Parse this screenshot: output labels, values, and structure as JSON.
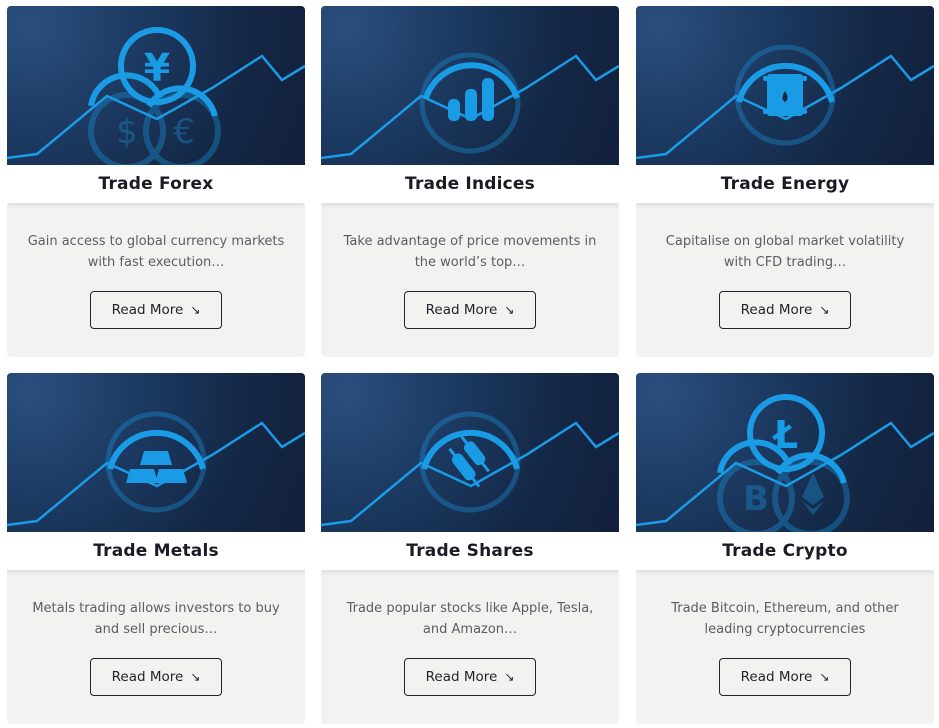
{
  "cards": [
    {
      "title": "Trade Forex",
      "description": "Gain access to global currency markets with fast execution…",
      "button_label": "Read More",
      "button_icon": "arrow-down-right-icon",
      "illustration": "forex-coins-icon"
    },
    {
      "title": "Trade Indices",
      "description": "Take advantage of price movements in the world’s top…",
      "button_label": "Read More",
      "button_icon": "arrow-down-right-icon",
      "illustration": "bar-chart-icon"
    },
    {
      "title": "Trade Energy",
      "description": "Capitalise on global market volatility with CFD trading…",
      "button_label": "Read More",
      "button_icon": "arrow-down-right-icon",
      "illustration": "oil-barrel-icon"
    },
    {
      "title": "Trade Metals",
      "description": "Metals trading allows investors to buy and sell precious…",
      "button_label": "Read More",
      "button_icon": "arrow-down-right-icon",
      "illustration": "gold-bars-icon"
    },
    {
      "title": "Trade Shares",
      "description": "Trade popular stocks like Apple, Tesla, and Amazon…",
      "button_label": "Read More",
      "button_icon": "arrow-down-right-icon",
      "illustration": "candlestick-icon"
    },
    {
      "title": "Trade Crypto",
      "description": "Trade Bitcoin, Ethereum, and other leading cryptocurrencies",
      "button_label": "Read More",
      "button_icon": "arrow-down-right-icon",
      "illustration": "crypto-coins-icon"
    }
  ],
  "colors": {
    "accent": "#1a9be6",
    "banner_dark": "#142846",
    "card_bg": "#f3f2f1",
    "title_text": "#1b1b26",
    "body_text": "#5d5c62"
  }
}
